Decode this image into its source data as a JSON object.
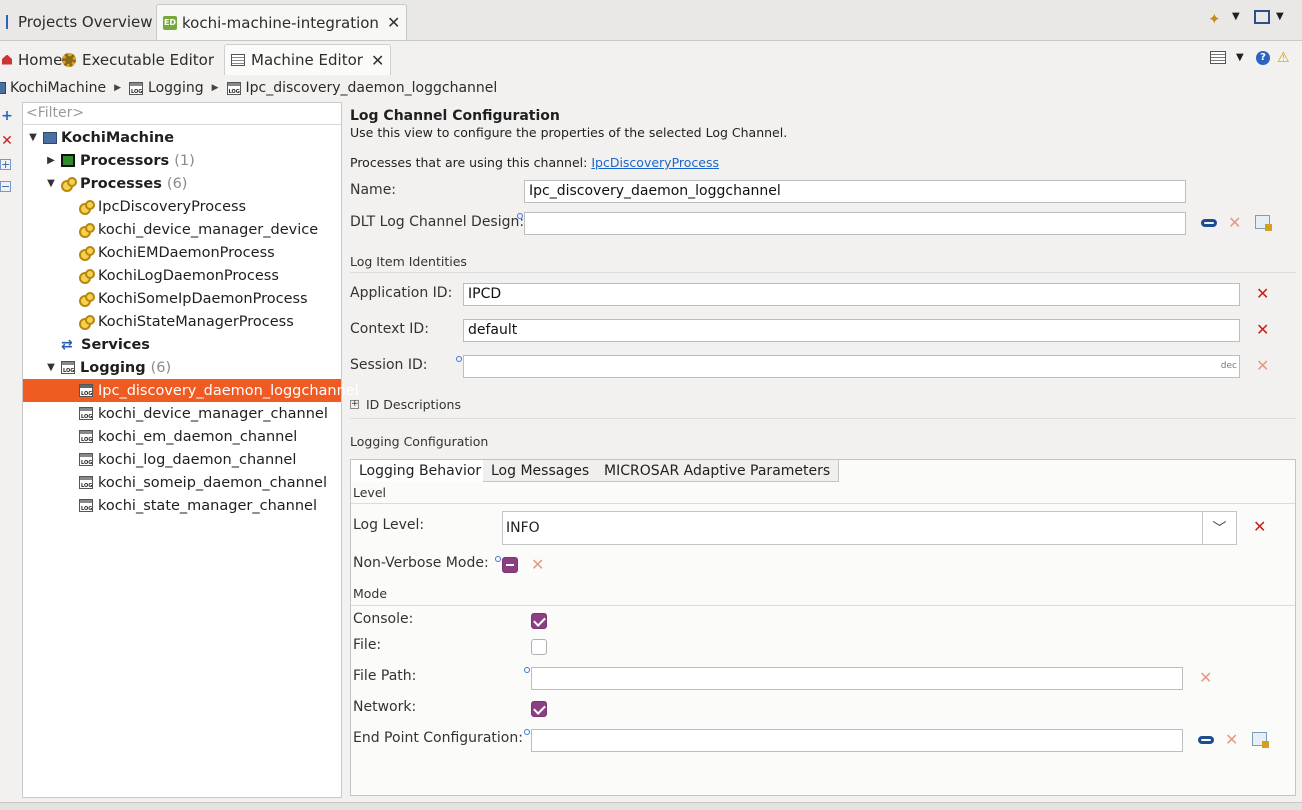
{
  "top_tabs": {
    "projects": "Projects Overview",
    "integration": "kochi-machine-integration",
    "integration_icon_text": "ED"
  },
  "editor_tabs": {
    "home": "Home",
    "executable": "Executable Editor",
    "machine": "Machine Editor"
  },
  "breadcrumb": [
    "KochiMachine",
    "Logging",
    "Ipc_discovery_daemon_loggchannel"
  ],
  "tree": {
    "filter_placeholder": "<Filter>",
    "root": "KochiMachine",
    "processors_label": "Processors",
    "processors_count": "(1)",
    "processes_label": "Processes",
    "processes_count": "(6)",
    "processes": [
      "IpcDiscoveryProcess",
      "kochi_device_manager_device",
      "KochiEMDaemonProcess",
      "KochiLogDaemonProcess",
      "KochiSomeIpDaemonProcess",
      "KochiStateManagerProcess"
    ],
    "services_label": "Services",
    "logging_label": "Logging",
    "logging_count": "(6)",
    "channels": [
      "Ipc_discovery_daemon_loggchannel",
      "kochi_device_manager_channel",
      "kochi_em_daemon_channel",
      "kochi_log_daemon_channel",
      "kochi_someip_daemon_channel",
      "kochi_state_manager_channel"
    ]
  },
  "form": {
    "title": "Log Channel Configuration",
    "subtitle": "Use this view to configure the properties of the selected Log Channel.",
    "processes_using_prefix": "Processes that are using this channel:",
    "processes_using_link": "IpcDiscoveryProcess",
    "name_label": "Name:",
    "name_value": "Ipc_discovery_daemon_loggchannel",
    "dlt_label": "DLT Log Channel Design:",
    "dlt_value": "",
    "log_item_identities": "Log Item Identities",
    "app_id_label": "Application ID:",
    "app_id_value": "IPCD",
    "context_id_label": "Context ID:",
    "context_id_value": "default",
    "session_id_label": "Session ID:",
    "session_id_value": "",
    "session_suffix": "dec",
    "id_descriptions": "ID Descriptions",
    "logging_configuration": "Logging Configuration",
    "tabs": [
      "Logging Behavior",
      "Log Messages",
      "MICROSAR Adaptive Parameters"
    ],
    "level_section": "Level",
    "log_level_label": "Log Level:",
    "log_level_value": "INFO",
    "non_verbose_label": "Non-Verbose Mode:",
    "mode_section": "Mode",
    "console_label": "Console:",
    "file_label": "File:",
    "file_path_label": "File Path:",
    "file_path_value": "",
    "network_label": "Network:",
    "endpoint_label": "End Point Configuration:",
    "endpoint_value": ""
  }
}
